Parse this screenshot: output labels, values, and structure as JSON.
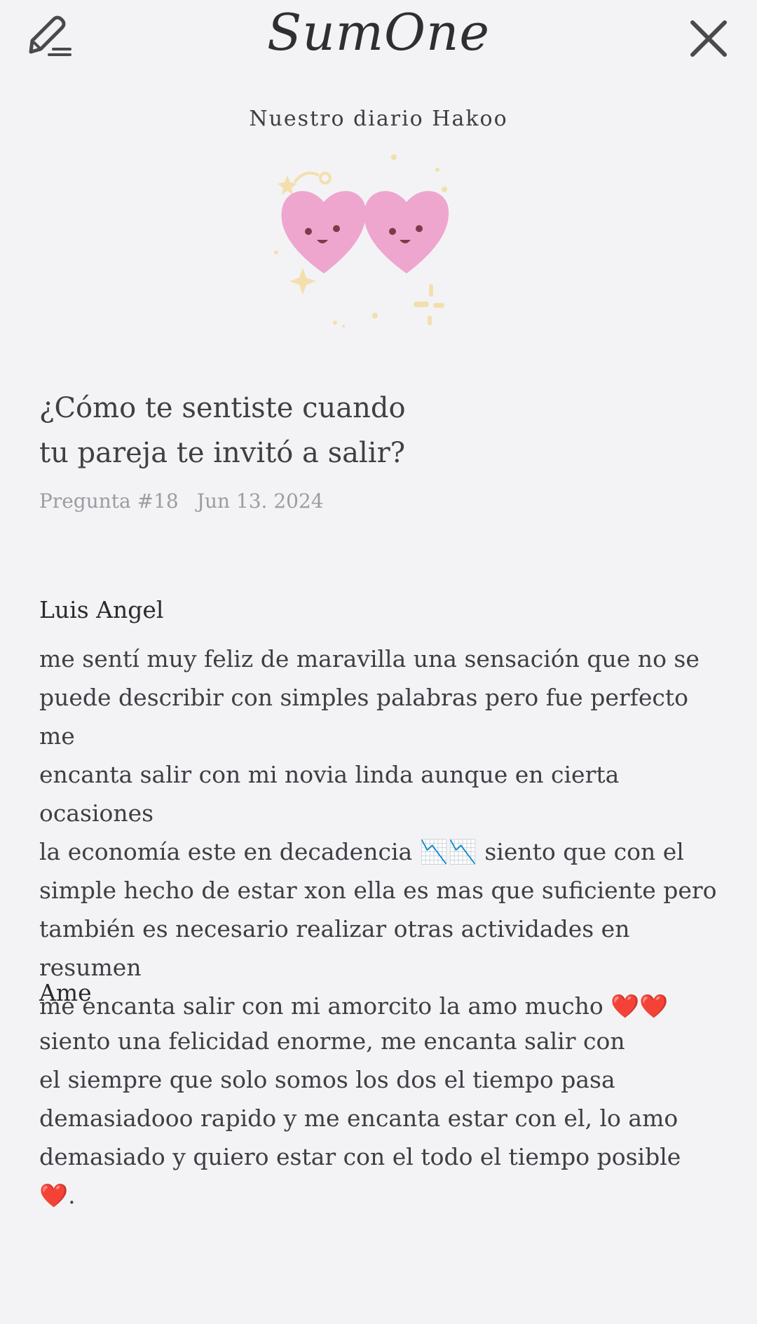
{
  "header": {
    "logo": "SumOne",
    "edit_icon": "edit-pen-icon",
    "close_icon": "close-icon"
  },
  "diary_name": "Nuestro diario Hakoo",
  "illustration": "two-smiling-hearts-icon",
  "question": {
    "line1": "¿Cómo te sentiste cuando",
    "line2": "tu pareja te invitó a salir?",
    "number": "Pregunta #18",
    "date": "Jun 13. 2024"
  },
  "answers": [
    {
      "name": "Luis Angel",
      "lines": [
        "me sentí muy feliz de maravilla una sensación que no se",
        "puede describir con simples palabras pero fue perfecto me",
        "encanta salir con mi novia linda aunque en cierta ocasiones",
        "la economía este en decadencia 📉📉 siento que con el",
        "simple hecho de estar xon ella es mas que suficiente pero",
        "también es necesario realizar otras actividades en resumen",
        "me encanta salir con mi amorcito la amo mucho ❤️❤️"
      ]
    },
    {
      "name": "Ame",
      "lines": [
        "siento una felicidad enorme, me encanta salir con",
        "el siempre que solo somos los dos el tiempo pasa",
        "demasiadooo rapido y me encanta estar con el, lo amo",
        "demasiado y quiero estar con el todo el tiempo posible❤️."
      ]
    }
  ],
  "colors": {
    "background": "#f3f3f5",
    "heart": "#eea6cf",
    "sparkle": "#f3dfae",
    "text": "#3e3e44",
    "meta": "#9c9ca2"
  }
}
